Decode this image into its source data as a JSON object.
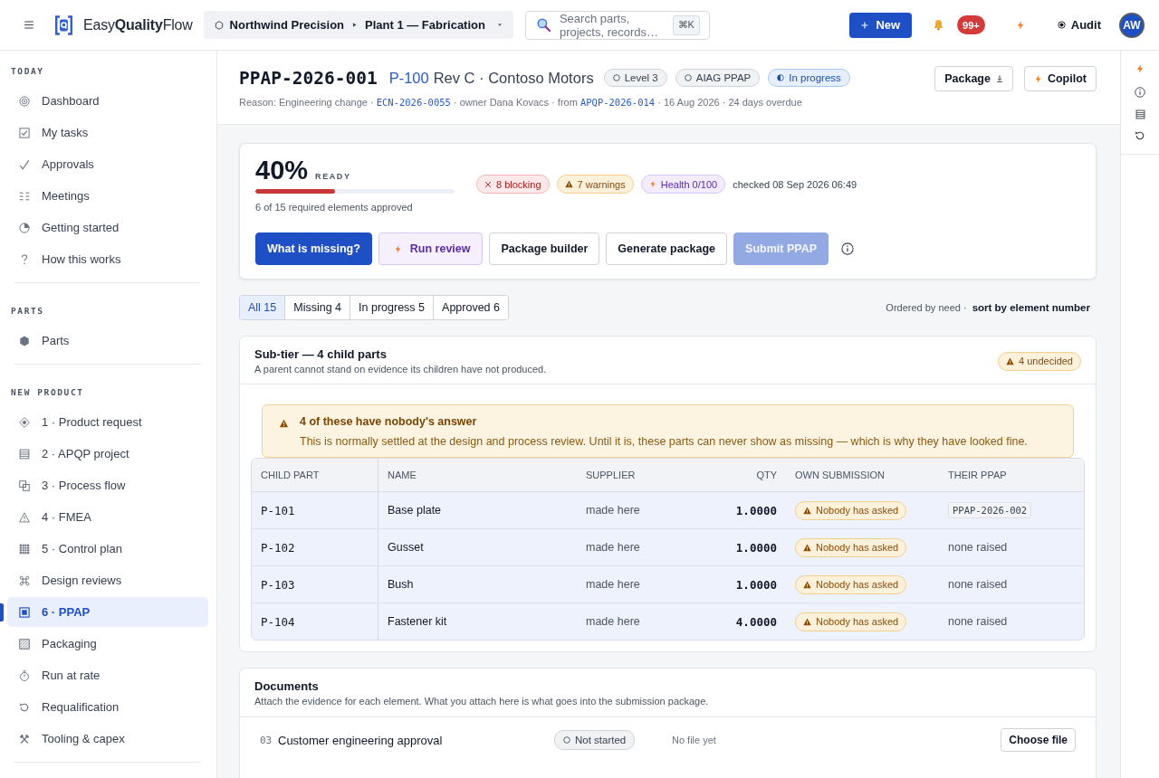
{
  "topbar": {
    "brand": "Easy**Quality**Flow",
    "workspace": {
      "org": "Northwind Precision",
      "site": "Plant 1 — Fabrication"
    },
    "search": {
      "placeholder": "Search parts, projects, records…",
      "shortcut": "⌘K"
    },
    "new_button": "New",
    "notifications": "99+",
    "audit": "Audit",
    "avatar": "AW"
  },
  "sidebar": {
    "sections": [
      {
        "title": "TODAY",
        "items": [
          {
            "label": "Dashboard",
            "selected": false
          },
          {
            "label": "My tasks",
            "selected": false
          },
          {
            "label": "Approvals",
            "selected": false
          },
          {
            "label": "Meetings",
            "selected": false
          },
          {
            "label": "Getting started",
            "selected": false
          },
          {
            "label": "How this works",
            "selected": false
          }
        ]
      },
      {
        "title": "PARTS",
        "items": [
          {
            "label": "Parts",
            "selected": false
          }
        ]
      },
      {
        "title": "NEW PRODUCT",
        "items": [
          {
            "label": "1 · Product request",
            "selected": false
          },
          {
            "label": "2 · APQP project",
            "selected": false
          },
          {
            "label": "3 · Process flow",
            "selected": false
          },
          {
            "label": "4 · FMEA",
            "selected": false
          },
          {
            "label": "5 · Control plan",
            "selected": false
          },
          {
            "label": "Design reviews",
            "selected": false
          },
          {
            "label": "6 · PPAP",
            "selected": true
          },
          {
            "label": "Packaging",
            "selected": false
          },
          {
            "label": "Run at rate",
            "selected": false
          },
          {
            "label": "Requalification",
            "selected": false
          },
          {
            "label": "Tooling & capex",
            "selected": false
          }
        ]
      }
    ]
  },
  "header": {
    "id": "PPAP-2026-001",
    "part": "P-100",
    "part_detail": "Rev C · Contoso Motors",
    "badges": [
      {
        "kind": "outline",
        "label": "Level 3"
      },
      {
        "kind": "outline",
        "label": "AIAG PPAP"
      },
      {
        "kind": "status",
        "label": "In progress"
      }
    ],
    "meta": [
      {
        "kind": "text",
        "text": "Reason: Engineering change · "
      },
      {
        "kind": "link",
        "text": "ECN-2026-0055"
      },
      {
        "kind": "text",
        "text": " · owner Dana Kovacs · from "
      },
      {
        "kind": "link",
        "text": "APQP-2026-014"
      },
      {
        "kind": "text",
        "text": " · 16 Aug 2026 · 24 days overdue"
      }
    ],
    "actions": [
      {
        "kind": "download",
        "label": "Package"
      },
      {
        "kind": "copilot",
        "label": "Copilot"
      }
    ]
  },
  "readiness": {
    "percent": "40%",
    "label": "READY",
    "level": 0.4,
    "summary": "6 of 15 required elements approved",
    "chips": [
      {
        "kind": "blocking",
        "label": "8 blocking"
      },
      {
        "kind": "warning",
        "label": "7 warnings"
      },
      {
        "kind": "health",
        "label": "Health 0/100"
      }
    ],
    "checked": "checked 08 Sep 2026 06:49",
    "actions": [
      {
        "kind": "primary",
        "label": "What is missing?",
        "disabled": false
      },
      {
        "kind": "ai",
        "label": "Run review",
        "disabled": false
      },
      {
        "kind": "default",
        "label": "Package builder",
        "disabled": false
      },
      {
        "kind": "default",
        "label": "Generate package",
        "disabled": false
      },
      {
        "kind": "primary",
        "label": "Submit PPAP",
        "disabled": true
      }
    ]
  },
  "filters": {
    "tabs": [
      {
        "label": "All 15",
        "selected": true
      },
      {
        "label": "Missing 4",
        "selected": false
      },
      {
        "label": "In progress 5",
        "selected": false
      },
      {
        "label": "Approved 6",
        "selected": false
      }
    ],
    "order_note": "Ordered by need ·",
    "sort_link": "sort by element number"
  },
  "subtier": {
    "title": "Sub-tier — 4 child parts",
    "subtitle": "A parent cannot stand on evidence its children have not produced.",
    "badge": "4 undecided",
    "alert": {
      "title": "4 of these have nobody's answer",
      "body": "This is normally settled at the design and process review. Until it is, these parts can never show as missing — which is why they have looked fine."
    },
    "columns": [
      "CHILD PART",
      "NAME",
      "SUPPLIER",
      "QTY",
      "OWN SUBMISSION",
      "THEIR PPAP"
    ],
    "rows": [
      {
        "part": "P-101",
        "name": "Base plate",
        "supplier": "made here",
        "qty": "1.0000",
        "submission": "Nobody has asked",
        "their_ppap": {
          "kind": "record",
          "text": "PPAP-2026-002"
        }
      },
      {
        "part": "P-102",
        "name": "Gusset",
        "supplier": "made here",
        "qty": "1.0000",
        "submission": "Nobody has asked",
        "their_ppap": {
          "kind": "none",
          "text": "none raised"
        }
      },
      {
        "part": "P-103",
        "name": "Bush",
        "supplier": "made here",
        "qty": "1.0000",
        "submission": "Nobody has asked",
        "their_ppap": {
          "kind": "none",
          "text": "none raised"
        }
      },
      {
        "part": "P-104",
        "name": "Fastener kit",
        "supplier": "made here",
        "qty": "4.0000",
        "submission": "Nobody has asked",
        "their_ppap": {
          "kind": "none",
          "text": "none raised"
        }
      }
    ]
  },
  "documents": {
    "title": "Documents",
    "subtitle": "Attach the evidence for each element. What you attach here is what goes into the submission package.",
    "rows": [
      {
        "number": "03",
        "name": "Customer engineering approval",
        "status": "Not started",
        "file": "No file yet",
        "action": "Choose file"
      }
    ]
  }
}
